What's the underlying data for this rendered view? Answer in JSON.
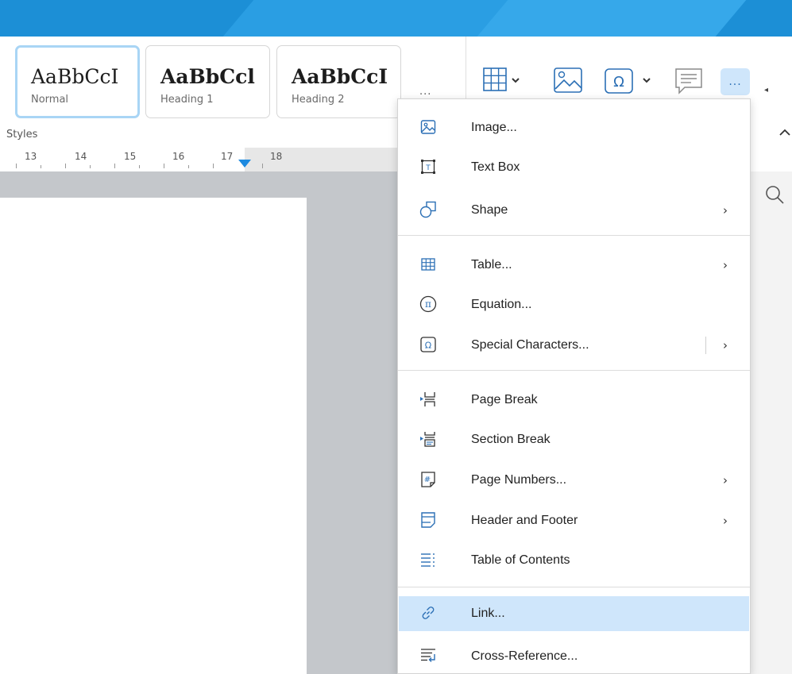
{
  "ribbon": {
    "styles_group_label": "Styles",
    "style_cards": [
      {
        "preview": "AaBbCcI",
        "name": "Normal",
        "selected": true
      },
      {
        "preview": "AaBbCcl",
        "name": "Heading 1",
        "selected": false
      },
      {
        "preview": "AaBbCcI",
        "name": "Heading 2",
        "selected": false
      }
    ],
    "more_styles": "...",
    "toolbar_more": "..."
  },
  "ruler": {
    "numbers": [
      "13",
      "14",
      "15",
      "16",
      "17",
      "18"
    ]
  },
  "menu": {
    "items": [
      {
        "label": "Image...",
        "icon": "image-icon",
        "submenu": false
      },
      {
        "label": "Text Box",
        "icon": "text-box-icon",
        "submenu": false
      },
      {
        "label": "Shape",
        "icon": "shape-icon",
        "submenu": true
      },
      {
        "label": "Table...",
        "icon": "table-icon",
        "submenu": true
      },
      {
        "label": "Equation...",
        "icon": "equation-icon",
        "submenu": false
      },
      {
        "label": "Special Characters...",
        "icon": "omega-icon",
        "submenu": true
      },
      {
        "label": "Page Break",
        "icon": "page-break-icon",
        "submenu": false
      },
      {
        "label": "Section Break",
        "icon": "section-break-icon",
        "submenu": false
      },
      {
        "label": "Page Numbers...",
        "icon": "page-numbers-icon",
        "submenu": true
      },
      {
        "label": "Header and Footer",
        "icon": "header-footer-icon",
        "submenu": true
      },
      {
        "label": "Table of Contents",
        "icon": "toc-icon",
        "submenu": false
      },
      {
        "label": "Link...",
        "icon": "link-icon",
        "submenu": false,
        "highlighted": true
      },
      {
        "label": "Cross-Reference...",
        "icon": "cross-reference-icon",
        "submenu": false
      }
    ]
  },
  "colors": {
    "accent": "#1c8fd6",
    "highlight": "#cfe6fb",
    "icon_blue": "#2b6fb5"
  }
}
